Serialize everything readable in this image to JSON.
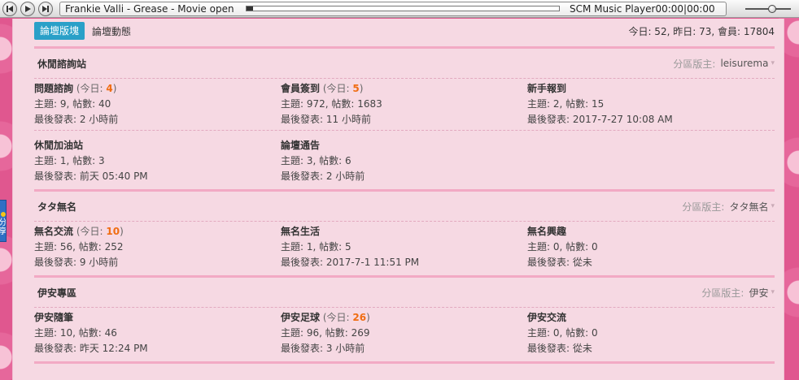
{
  "player": {
    "track": "Frankie Valli - Grease - Movie open",
    "player_name": "SCM Music Player",
    "time": "00:00|00:00",
    "progress": 0.02,
    "volume": 0.6
  },
  "side_tab": {
    "text": "分\n享"
  },
  "nav": {
    "tabs": [
      {
        "label": "論壇版塊",
        "active": true
      },
      {
        "label": "論壇動態",
        "active": false
      }
    ],
    "stats": "今日: 52, 昨日: 73, 會員: 17804"
  },
  "labels": {
    "topics_prefix": "主題: ",
    "posts_prefix": ", 帖數: ",
    "last_prefix": "最後發表: ",
    "today_open": " (今日: ",
    "today_close": ")",
    "mod_label": "分區版主: "
  },
  "sections": [
    {
      "title": "休閒諮詢站",
      "moderator": "leisurema",
      "forums": [
        {
          "name": "問題諮詢",
          "today": "4",
          "topics": "9",
          "posts": "40",
          "last": "2 小時前"
        },
        {
          "name": "會員簽到",
          "today": "5",
          "topics": "972",
          "posts": "1683",
          "last": "11 小時前"
        },
        {
          "name": "新手報到",
          "today": null,
          "topics": "2",
          "posts": "15",
          "last": "2017-7-27 10:08 AM"
        },
        {
          "name": "休閒加油站",
          "today": null,
          "topics": "1",
          "posts": "3",
          "last": "前天 05:40 PM"
        },
        {
          "name": "論壇通告",
          "today": null,
          "topics": "3",
          "posts": "6",
          "last": "2 小時前"
        }
      ]
    },
    {
      "title": "タタ無名",
      "moderator": "タタ無名",
      "forums": [
        {
          "name": "無名交流",
          "today": "10",
          "topics": "56",
          "posts": "252",
          "last": "9 小時前"
        },
        {
          "name": "無名生活",
          "today": null,
          "topics": "1",
          "posts": "5",
          "last": "2017-7-1 11:51 PM"
        },
        {
          "name": "無名興趣",
          "today": null,
          "topics": "0",
          "posts": "0",
          "last": "從未"
        }
      ]
    },
    {
      "title": "伊安專區",
      "moderator": "伊安",
      "forums": [
        {
          "name": "伊安隨筆",
          "today": null,
          "topics": "10",
          "posts": "46",
          "last": "昨天 12:24 PM"
        },
        {
          "name": "伊安足球",
          "today": "26",
          "topics": "96",
          "posts": "269",
          "last": "3 小時前"
        },
        {
          "name": "伊安交流",
          "today": null,
          "topics": "0",
          "posts": "0",
          "last": "從未"
        }
      ]
    }
  ],
  "colors": {
    "accent_tab": "#2aa0c8",
    "today_number": "#f06d12",
    "panel_bg": "#f6d9e3",
    "page_bg": "#e0578f"
  }
}
